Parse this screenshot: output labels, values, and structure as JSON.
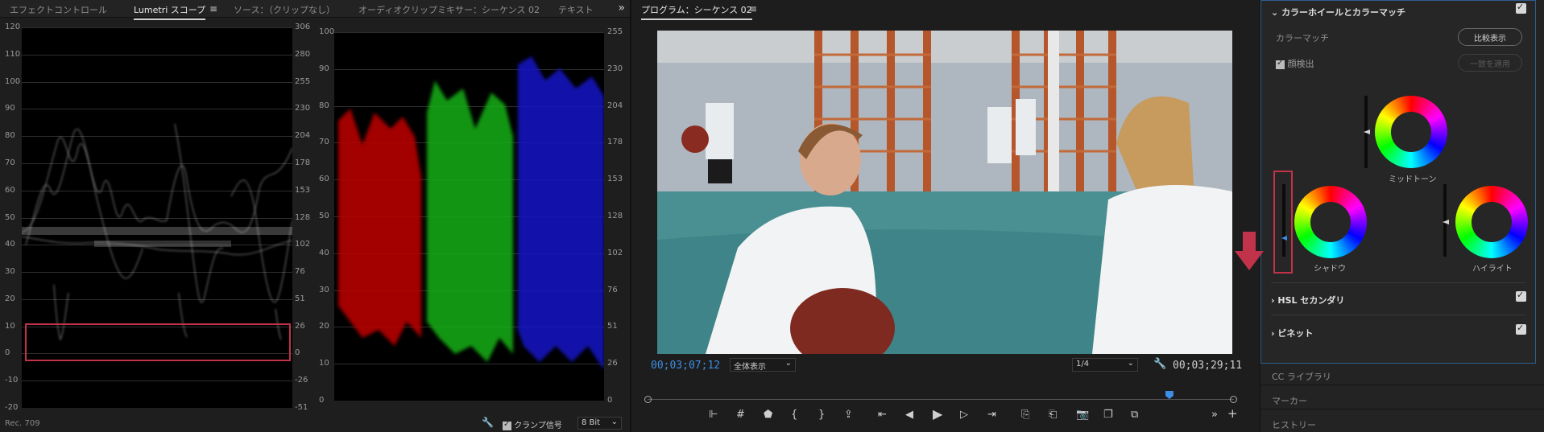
{
  "left_panel": {
    "tabs": [
      "エフェクトコントロール",
      "Lumetri スコープ",
      "ソース：（クリップなし）",
      "オーディオクリップミキサー：シーケンス 02",
      "テキスト"
    ],
    "active_tab": "Lumetri スコープ",
    "luma_waveform": {
      "left_ticks": [
        "120",
        "110",
        "100",
        "90",
        "80",
        "70",
        "60",
        "50",
        "40",
        "30",
        "20",
        "10",
        "0",
        "-10",
        "-20"
      ],
      "right_ticks": [
        "306",
        "280",
        "255",
        "230",
        "204",
        "178",
        "153",
        "128",
        "102",
        "76",
        "51",
        "26",
        "0",
        "-26",
        "-51"
      ]
    },
    "rgb_parade": {
      "left_ticks": [
        "100",
        "90",
        "80",
        "70",
        "60",
        "50",
        "40",
        "30",
        "20",
        "10",
        "0"
      ],
      "right_ticks": [
        "255",
        "230",
        "204",
        "178",
        "153",
        "128",
        "102",
        "76",
        "51",
        "26",
        "0"
      ]
    },
    "footer": {
      "colorspace": "Rec. 709",
      "clamp_label": "クランプ信号",
      "bit_depth": "8 Bit"
    }
  },
  "program": {
    "title": "プログラム：シーケンス 02",
    "current_timecode": "00;03;07;12",
    "zoom": "全体表示",
    "resolution": "1/4",
    "duration_timecode": "00;03;29;11",
    "playhead_fraction": 0.89
  },
  "lumetri": {
    "section_title": "カラーホイールとカラーマッチ",
    "color_match_label": "カラーマッチ",
    "compare_button": "比較表示",
    "face_detect_label": "顔検出",
    "apply_match_button": "一致を適用",
    "wheels": {
      "midtones": "ミッドトーン",
      "shadows": "シャドウ",
      "highlights": "ハイライト"
    },
    "hsl_secondary": "HSL セカンダリ",
    "vignette": "ビネット",
    "panel_tabs": [
      "CC ライブラリ",
      "マーカー",
      "ヒストリー"
    ]
  }
}
